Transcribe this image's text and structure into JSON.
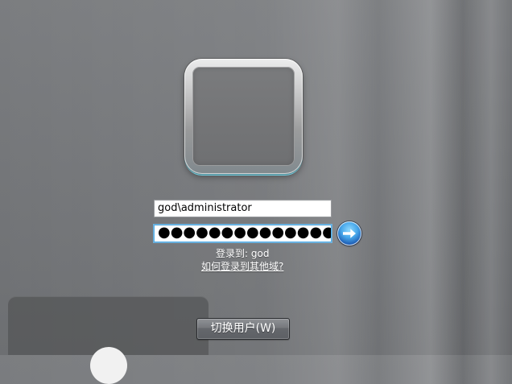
{
  "login": {
    "username_value": "god\\administrator",
    "password_mask": "●●●●●●●●●●●●●●",
    "logon_to_text": "登录到: god",
    "domain_help_link": "如何登录到其他域?",
    "submit_icon": "arrow-right-icon"
  },
  "account_tile": {
    "icon": "user-picture-frame"
  },
  "footer": {
    "switch_user_label": "切换用户(W)"
  },
  "colors": {
    "background": "#77797c",
    "field_focus": "#52aee8",
    "accent_blue": "#2f7fd1"
  }
}
